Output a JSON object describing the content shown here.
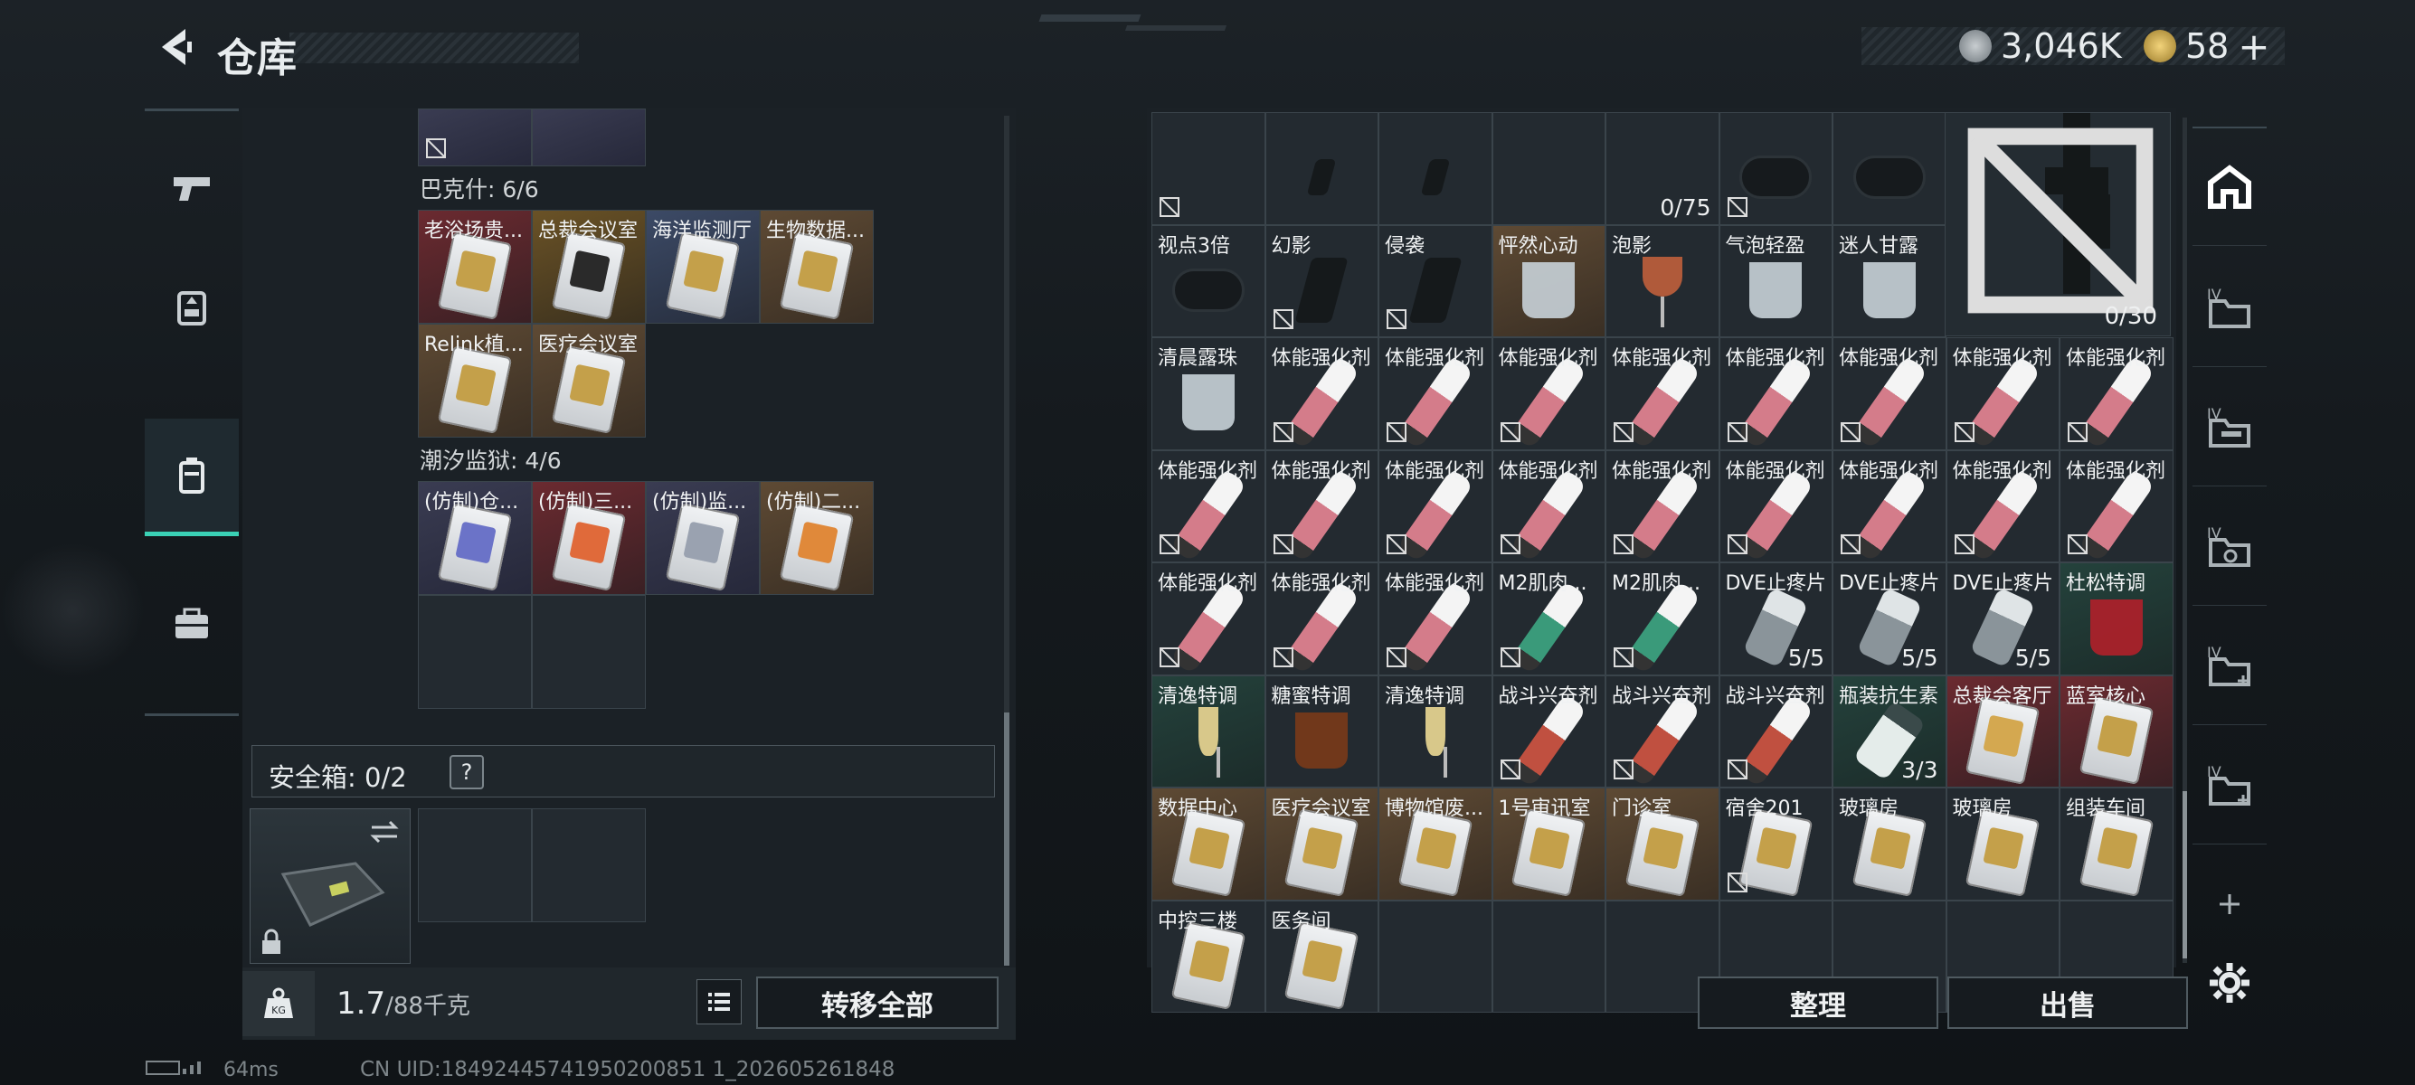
{
  "header": {
    "title": "仓库",
    "currency_silver": "3,046K",
    "currency_gold": "58"
  },
  "left": {
    "group_bakesh": {
      "label": "巴克什: 6/6",
      "items": [
        {
          "name": "老浴场贵...",
          "color": "red"
        },
        {
          "name": "总裁会议室",
          "color": "gold"
        },
        {
          "name": "海洋监测厅",
          "color": "blue"
        },
        {
          "name": "生物数据...",
          "color": "brown"
        },
        {
          "name": "Relink植...",
          "color": "brown"
        },
        {
          "name": "医疗会议室",
          "color": "brown"
        }
      ]
    },
    "group_chaoxi": {
      "label": "潮汐监狱: 4/6",
      "items": [
        {
          "name": "(仿制)仓...",
          "color": "purple"
        },
        {
          "name": "(仿制)三...",
          "color": "red"
        },
        {
          "name": "(仿制)监...",
          "color": "purple"
        },
        {
          "name": "(仿制)二...",
          "color": "brown"
        }
      ]
    },
    "safe_box": {
      "label": "安全箱: 0/2",
      "help": "?"
    },
    "footer": {
      "weight": "1.7",
      "weight_max": "/88千克",
      "transfer_all": "转移全部"
    }
  },
  "right": {
    "top_row": [
      {
        "count": ""
      },
      {
        "count": ""
      },
      {
        "count": ""
      },
      {
        "count": ""
      },
      {
        "count": "0/75"
      },
      {
        "count": ""
      },
      {
        "count": ""
      }
    ],
    "rows": [
      [
        {
          "n": "视点3倍",
          "c": "dark",
          "i": "scope"
        },
        {
          "n": "幻影",
          "c": "dark",
          "i": "grip"
        },
        {
          "n": "侵袭",
          "c": "dark",
          "i": "grip"
        },
        {
          "n": "怦然心动",
          "c": "brown",
          "i": "glass"
        },
        {
          "n": "泡影",
          "c": "dark",
          "i": "wine"
        },
        {
          "n": "气泡轻盈",
          "c": "dark",
          "i": "glass"
        },
        {
          "n": "迷人甘露",
          "c": "dark",
          "i": "glass"
        }
      ],
      [
        {
          "n": "清晨露珠",
          "c": "dark",
          "i": "glass"
        },
        {
          "n": "体能强化剂",
          "c": "dark",
          "i": "vial"
        },
        {
          "n": "体能强化剂",
          "c": "dark",
          "i": "vial"
        },
        {
          "n": "体能强化剂",
          "c": "dark",
          "i": "vial"
        },
        {
          "n": "体能强化剂",
          "c": "dark",
          "i": "vial"
        },
        {
          "n": "体能强化剂",
          "c": "dark",
          "i": "vial"
        },
        {
          "n": "体能强化剂",
          "c": "dark",
          "i": "vial"
        },
        {
          "n": "体能强化剂",
          "c": "dark",
          "i": "vial"
        },
        {
          "n": "体能强化剂",
          "c": "dark",
          "i": "vial"
        }
      ],
      [
        {
          "n": "体能强化剂",
          "c": "dark",
          "i": "vial"
        },
        {
          "n": "体能强化剂",
          "c": "dark",
          "i": "vial"
        },
        {
          "n": "体能强化剂",
          "c": "dark",
          "i": "vial"
        },
        {
          "n": "体能强化剂",
          "c": "dark",
          "i": "vial"
        },
        {
          "n": "体能强化剂",
          "c": "dark",
          "i": "vial"
        },
        {
          "n": "体能强化剂",
          "c": "dark",
          "i": "vial"
        },
        {
          "n": "体能强化剂",
          "c": "dark",
          "i": "vial"
        },
        {
          "n": "体能强化剂",
          "c": "dark",
          "i": "vial"
        },
        {
          "n": "体能强化剂",
          "c": "dark",
          "i": "vial"
        }
      ],
      [
        {
          "n": "体能强化剂",
          "c": "dark",
          "i": "vial"
        },
        {
          "n": "体能强化剂",
          "c": "dark",
          "i": "vial"
        },
        {
          "n": "体能强化剂",
          "c": "dark",
          "i": "vial"
        },
        {
          "n": "M2肌肉...",
          "c": "dark",
          "i": "vialg"
        },
        {
          "n": "M2肌肉...",
          "c": "dark",
          "i": "vialg"
        },
        {
          "n": "DVE止疼片",
          "c": "dark",
          "i": "pill",
          "ct": "5/5"
        },
        {
          "n": "DVE止疼片",
          "c": "dark",
          "i": "pill",
          "ct": "5/5"
        },
        {
          "n": "DVE止疼片",
          "c": "dark",
          "i": "pill",
          "ct": "5/5"
        },
        {
          "n": "杜松特调",
          "c": "teal",
          "i": "glassr"
        }
      ],
      [
        {
          "n": "清逸特调",
          "c": "teal",
          "i": "champ"
        },
        {
          "n": "糖蜜特调",
          "c": "dark",
          "i": "glassb"
        },
        {
          "n": "清逸特调",
          "c": "dark",
          "i": "champ"
        },
        {
          "n": "战斗兴奋剂",
          "c": "dark",
          "i": "vialr"
        },
        {
          "n": "战斗兴奋剂",
          "c": "dark",
          "i": "vialr"
        },
        {
          "n": "战斗兴奋剂",
          "c": "dark",
          "i": "vialr"
        },
        {
          "n": "瓶装抗生素",
          "c": "teal",
          "i": "bottle",
          "ct": "3/3"
        },
        {
          "n": "总裁会客厅",
          "c": "red",
          "i": "cardg"
        },
        {
          "n": "蓝室核心",
          "c": "red",
          "i": "card"
        }
      ],
      [
        {
          "n": "数据中心",
          "c": "brown",
          "i": "card"
        },
        {
          "n": "医疗会议室",
          "c": "brown",
          "i": "card"
        },
        {
          "n": "博物馆废...",
          "c": "brown",
          "i": "card"
        },
        {
          "n": "1号审讯室",
          "c": "brown",
          "i": "card"
        },
        {
          "n": "门诊室",
          "c": "brown",
          "i": "card"
        },
        {
          "n": "宿舍201",
          "c": "dark",
          "i": "card"
        },
        {
          "n": "玻璃房",
          "c": "dark",
          "i": "card"
        },
        {
          "n": "玻璃房",
          "c": "dark",
          "i": "card"
        },
        {
          "n": "组装车间",
          "c": "dark",
          "i": "card"
        }
      ],
      [
        {
          "n": "中控三楼",
          "c": "dark",
          "i": "card"
        },
        {
          "n": "医务间",
          "c": "dark",
          "i": "card"
        },
        {
          "n": "",
          "c": "dark",
          "i": ""
        },
        {
          "n": "",
          "c": "dark",
          "i": ""
        },
        {
          "n": "",
          "c": "dark",
          "i": ""
        },
        {
          "n": "",
          "c": "dark",
          "i": ""
        },
        {
          "n": "",
          "c": "dark",
          "i": ""
        },
        {
          "n": "",
          "c": "dark",
          "i": ""
        },
        {
          "n": "",
          "c": "dark",
          "i": ""
        }
      ]
    ],
    "big_weapon_count": "0/30",
    "sort_label": "整理",
    "sell_label": "出售"
  },
  "status": {
    "ping": "64ms",
    "uid": "CN UID:18492445741950200851 1_202605261848"
  }
}
